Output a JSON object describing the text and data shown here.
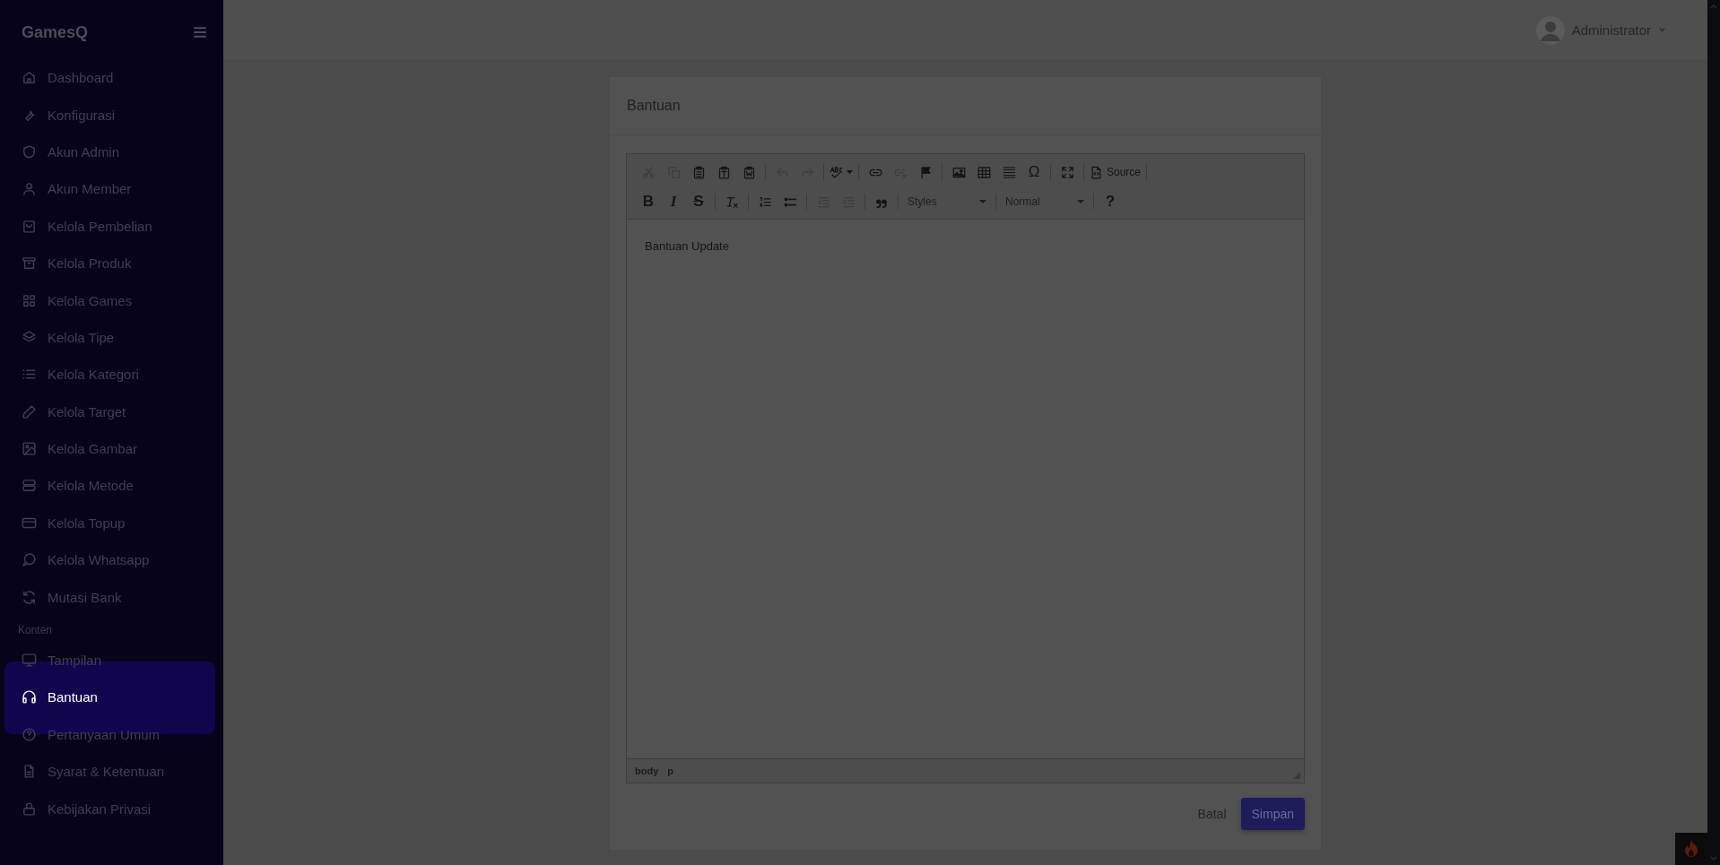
{
  "sidebar": {
    "brand": "GamesQ",
    "sections": [
      {
        "items": [
          {
            "label": "Dashboard",
            "selected": false
          },
          {
            "label": "Konfigurasi",
            "selected": false
          },
          {
            "label": "Akun Admin",
            "selected": false
          },
          {
            "label": "Akun Member",
            "selected": false
          },
          {
            "label": "Kelola Pembelian",
            "selected": false
          },
          {
            "label": "Kelola Produk",
            "selected": false
          },
          {
            "label": "Kelola Games",
            "selected": false
          },
          {
            "label": "Kelola Tipe",
            "selected": false
          },
          {
            "label": "Kelola Kategori",
            "selected": false
          },
          {
            "label": "Kelola Target",
            "selected": false
          },
          {
            "label": "Kelola Gambar",
            "selected": false
          },
          {
            "label": "Kelola Metode",
            "selected": false
          },
          {
            "label": "Kelola Topup",
            "selected": false
          },
          {
            "label": "Kelola Whatsapp",
            "selected": false
          },
          {
            "label": "Mutasi Bank",
            "selected": false
          }
        ]
      },
      {
        "heading": "Konten",
        "items": [
          {
            "label": "Tampilan",
            "selected": false
          },
          {
            "label": "Bantuan",
            "selected": true
          },
          {
            "label": "Pertanyaan Umum",
            "selected": false
          },
          {
            "label": "Syarat & Ketentuan",
            "selected": false
          },
          {
            "label": "Kebijakan Privasi",
            "selected": false
          }
        ]
      }
    ]
  },
  "topbar": {
    "user": "Administrator"
  },
  "card": {
    "title": "Bantuan",
    "editor": {
      "toolbar": [
        [
          {
            "kind": "icon",
            "disabled": true
          },
          {
            "kind": "icon",
            "disabled": true
          },
          {
            "kind": "icon",
            "disabled": false
          },
          {
            "kind": "icon",
            "disabled": false
          },
          {
            "kind": "icon",
            "disabled": false
          },
          {
            "kind": "separator"
          },
          {
            "kind": "icon",
            "disabled": true
          },
          {
            "kind": "icon",
            "disabled": true
          },
          {
            "kind": "separator"
          },
          {
            "kind": "icon",
            "disabled": false
          },
          {
            "kind": "separator"
          },
          {
            "kind": "icon",
            "disabled": false
          },
          {
            "kind": "icon",
            "disabled": true
          },
          {
            "kind": "icon",
            "disabled": false
          },
          {
            "kind": "separator"
          },
          {
            "kind": "icon",
            "disabled": false
          },
          {
            "kind": "icon",
            "disabled": false
          },
          {
            "kind": "icon",
            "disabled": false
          },
          {
            "kind": "glyph",
            "text": "Ω",
            "disabled": false
          },
          {
            "kind": "separator"
          },
          {
            "kind": "icon",
            "disabled": false
          },
          {
            "kind": "separator"
          },
          {
            "kind": "labeled",
            "text": "Source",
            "disabled": false
          },
          {
            "kind": "separator"
          }
        ],
        [
          {
            "kind": "glyph",
            "text": "B",
            "disabled": false
          },
          {
            "kind": "glyph",
            "text": "I",
            "disabled": false
          },
          {
            "kind": "glyph",
            "text": "S",
            "disabled": false
          },
          {
            "kind": "separator"
          },
          {
            "kind": "icon",
            "disabled": false
          },
          {
            "kind": "separator"
          },
          {
            "kind": "icon",
            "disabled": false
          },
          {
            "kind": "icon",
            "disabled": false
          },
          {
            "kind": "separator"
          },
          {
            "kind": "icon",
            "disabled": true
          },
          {
            "kind": "icon",
            "disabled": true
          },
          {
            "kind": "separator"
          },
          {
            "kind": "icon",
            "disabled": false
          },
          {
            "kind": "separator"
          },
          {
            "kind": "combo",
            "text": "Styles"
          },
          {
            "kind": "separator"
          },
          {
            "kind": "combo",
            "text": "Normal"
          },
          {
            "kind": "separator"
          },
          {
            "kind": "glyph",
            "text": "?",
            "disabled": false
          }
        ]
      ],
      "content": "Bantuan Update",
      "path": [
        "body",
        "p"
      ]
    },
    "buttons": [
      {
        "label": "Batal",
        "kind": "link"
      },
      {
        "label": "Simpan",
        "kind": "primary"
      }
    ]
  }
}
